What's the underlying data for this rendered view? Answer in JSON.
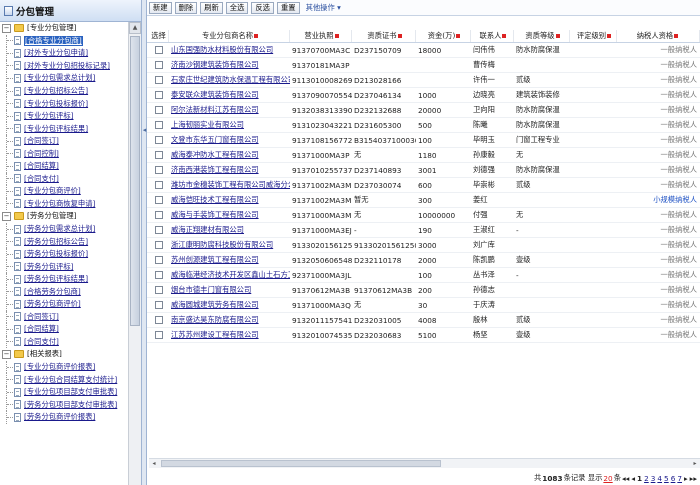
{
  "sidebar": {
    "title": "分包管理",
    "groups": [
      {
        "label": "[专业分包管理]",
        "items": [
          {
            "label": "[合格专业分包商]",
            "active": true
          },
          {
            "label": "[对外专业分包申请]"
          },
          {
            "label": "[对外专业分包招投标记录]"
          },
          {
            "label": "[专业分包需求总计划]"
          },
          {
            "label": "[专业分包招标公告]"
          },
          {
            "label": "[专业分包投标报价]"
          },
          {
            "label": "[专业分包评标]"
          },
          {
            "label": "[专业分包评标结果]"
          },
          {
            "label": "[合同签订]"
          },
          {
            "label": "[合同控制]"
          },
          {
            "label": "[合同结算]"
          },
          {
            "label": "[合同支付]"
          },
          {
            "label": "[专业分包商评价]"
          },
          {
            "label": "[专业分包商恢复申请]"
          }
        ]
      },
      {
        "label": "[劳务分包管理]",
        "items": [
          {
            "label": "[劳务分包需求总计划]"
          },
          {
            "label": "[劳务分包招标公告]"
          },
          {
            "label": "[劳务分包投标报价]"
          },
          {
            "label": "[劳务分包评标]"
          },
          {
            "label": "[劳务分包评标结果]"
          },
          {
            "label": "[合格劳务分包商]"
          },
          {
            "label": "[劳务分包商评价]"
          },
          {
            "label": "[合同签订]"
          },
          {
            "label": "[合同结算]"
          },
          {
            "label": "[合同支付]"
          }
        ]
      },
      {
        "label": "[相关报表]",
        "items": [
          {
            "label": "[专业分包商评价报表]"
          },
          {
            "label": "[专业分包合同结算支付统计]"
          },
          {
            "label": "[专业分包项目部支付审批表]"
          },
          {
            "label": "[劳务分包项目部支付审批表]"
          },
          {
            "label": "[劳务分包商评价报表]"
          }
        ]
      }
    ]
  },
  "toolbar": {
    "buttons": [
      "新建",
      "删除",
      "刷新",
      "全选",
      "反选",
      "重置"
    ],
    "more_label": "其他操作"
  },
  "table": {
    "headers": [
      "选择",
      "专业分包商名称",
      "营业执照",
      "资质证书",
      "资金(万)",
      "联系人",
      "资质等级",
      "评定级别",
      "纳税人资格"
    ],
    "rows": [
      {
        "name": "山东国强防水材料股份有限公司",
        "license": "91370700MA3C",
        "cert": "D237150709",
        "capital": "18000",
        "contact": "闫伟伟",
        "qual": "防水防腐保温",
        "eval": "",
        "tax": "一般纳税人"
      },
      {
        "name": "济南沙钢建筑装饰有限公司",
        "license": "91370181MA3P",
        "cert": "",
        "capital": "",
        "contact": "曹传梅",
        "qual": "",
        "eval": "",
        "tax": "一般纳税人"
      },
      {
        "name": "石家庄世纪建筑防水保温工程有限公司",
        "license": "91130100082690",
        "cert": "D213028166",
        "capital": "",
        "contact": "许伟一",
        "qual": "贰级",
        "eval": "",
        "tax": "一般纳税人"
      },
      {
        "name": "泰安联众建筑装饰有限公司",
        "license": "91370900705543",
        "cert": "D237046134",
        "capital": "1000",
        "contact": "边晓亮",
        "qual": "建筑装饰装修",
        "eval": "",
        "tax": "一般纳税人"
      },
      {
        "name": "阿尔法新材料江苏有限公司",
        "license": "91320383133906",
        "cert": "D232132688",
        "capital": "20000",
        "contact": "卫向阳",
        "qual": "防水防腐保温",
        "eval": "",
        "tax": "一般纳税人"
      },
      {
        "name": "上海韧丽实业有限公司",
        "license": "91310230432210",
        "cert": "D231605300",
        "capital": "500",
        "contact": "陈曦",
        "qual": "防水防腐保温",
        "eval": "",
        "tax": "一般纳税人"
      },
      {
        "name": "文登市东华五门窗有限公司",
        "license": "91371081567720",
        "cert": "B3154037100030",
        "capital": "100",
        "contact": "毕明玉",
        "qual": "门窗工程专业",
        "eval": "",
        "tax": "一般纳税人"
      },
      {
        "name": "威海泰冲防水工程有限公司",
        "license": "91371000MA3P",
        "cert": "无",
        "capital": "1180",
        "contact": "孙康毅",
        "qual": "无",
        "eval": "",
        "tax": "一般纳税人"
      },
      {
        "name": "济南西港装饰工程有限公司",
        "license": "91370102557374",
        "cert": "D237140893",
        "capital": "3001",
        "contact": "刘德强",
        "qual": "防水防腐保温",
        "eval": "",
        "tax": "一般纳税人"
      },
      {
        "name": "潍坊市金穗装饰工程有限公司威海分公司",
        "license": "91371002MA3M",
        "cert": "D237030074",
        "capital": "600",
        "contact": "毕崇彬",
        "qual": "贰级",
        "eval": "",
        "tax": "一般纳税人"
      },
      {
        "name": "威海恺旺技术工程有限公司",
        "license": "91371002MA3M",
        "cert": "暂无",
        "capital": "300",
        "contact": "姜红",
        "qual": "",
        "eval": "",
        "tax": "小规模纳税人"
      },
      {
        "name": "威海与手装饰工程有限公司",
        "license": "91371000MA3M",
        "cert": "无",
        "capital": "10000000",
        "contact": "付强",
        "qual": "无",
        "eval": "",
        "tax": "一般纳税人"
      },
      {
        "name": "威海正翔建材有限公司",
        "license": "91371000MA3EJ",
        "cert": "-",
        "capital": "190",
        "contact": "王淑红",
        "qual": "-",
        "eval": "",
        "tax": "一般纳税人"
      },
      {
        "name": "浙江康明防腐科技股份有限公司",
        "license": "91330201561250",
        "cert": "91330201561250",
        "capital": "3000",
        "contact": "刘广库",
        "qual": "",
        "eval": "",
        "tax": "一般纳税人"
      },
      {
        "name": "苏州创源建筑工程有限公司",
        "license": "91320506065480",
        "cert": "D232110178",
        "capital": "2000",
        "contact": "陈凯鹏",
        "qual": "壹级",
        "eval": "",
        "tax": "一般纳税人"
      },
      {
        "name": "威海临港经济技术开发区鑫山土石方工程有限公司",
        "license": "92371000MA3JL",
        "cert": "",
        "capital": "100",
        "contact": "丛书泽",
        "qual": "-",
        "eval": "",
        "tax": "一般纳税人"
      },
      {
        "name": "烟台市德丰门窗有限公司",
        "license": "91370612MA3B",
        "cert": "91370612MA3B",
        "capital": "200",
        "contact": "孙德志",
        "qual": "",
        "eval": "",
        "tax": "一般纳税人"
      },
      {
        "name": "威海圆城建筑劳务有限公司",
        "license": "91371000MA3Q",
        "cert": "无",
        "capital": "30",
        "contact": "于庆涛",
        "qual": "",
        "eval": "",
        "tax": "一般纳税人"
      },
      {
        "name": "南京盛达昊东防腐有限公司",
        "license": "91320111575414",
        "cert": "D232031005",
        "capital": "4008",
        "contact": "殷林",
        "qual": "贰级",
        "eval": "",
        "tax": "一般纳税人"
      },
      {
        "name": "江苏苏州建设工程有限公司",
        "license": "91320100745350",
        "cert": "D232030683",
        "capital": "5100",
        "contact": "杨坚",
        "qual": "壹级",
        "eval": "",
        "tax": "一般纳税人"
      }
    ]
  },
  "pager": {
    "total_prefix": "共",
    "total": "1083",
    "total_suffix": "条记录 显示",
    "page_size": "20",
    "size_suffix": "条",
    "nav_first": "◂◂",
    "nav_prev": "◂",
    "current": "1",
    "pages": [
      "2",
      "3",
      "4",
      "5",
      "6",
      "7"
    ],
    "nav_next": "▸",
    "nav_last": "▸▸"
  },
  "colors": {
    "accent": "#2a62c0",
    "link": "#1a1a8c",
    "small_taxpayer": "#1f52c4"
  }
}
